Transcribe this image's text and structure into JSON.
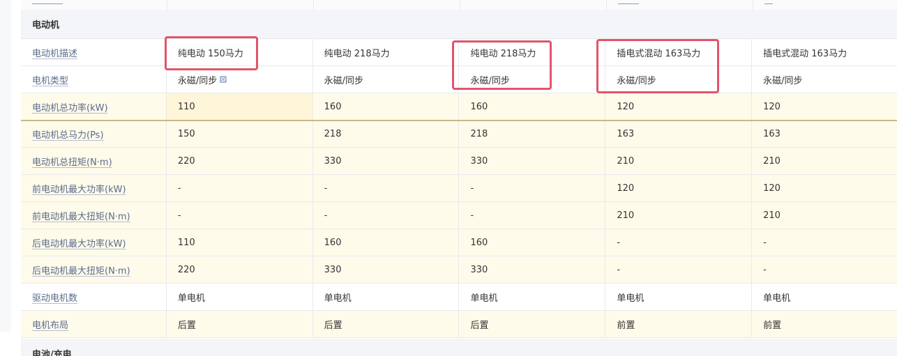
{
  "section": {
    "title": "电动机",
    "next_title": "电池/充电"
  },
  "rows": [
    {
      "label": "电动机描述",
      "values": [
        "纯电动 150马力",
        "纯电动 218马力",
        "纯电动 218马力",
        "插电式混动 163马力",
        "插电式混动 163马力"
      ],
      "style": "white"
    },
    {
      "label": "电机类型",
      "values": [
        "永磁/同步",
        "永磁/同步",
        "永磁/同步",
        "永磁/同步",
        "永磁/同步"
      ],
      "style": "white"
    },
    {
      "label": "电动机总功率(kW)",
      "values": [
        "110",
        "160",
        "160",
        "120",
        "120"
      ],
      "style": "yellow"
    },
    {
      "label": "电动机总马力(Ps)",
      "values": [
        "150",
        "218",
        "218",
        "163",
        "163"
      ],
      "style": "yellow"
    },
    {
      "label": "电动机总扭矩(N·m)",
      "values": [
        "220",
        "330",
        "330",
        "210",
        "210"
      ],
      "style": "yellow"
    },
    {
      "label": "前电动机最大功率(kW)",
      "values": [
        "-",
        "-",
        "-",
        "120",
        "120"
      ],
      "style": "yellow"
    },
    {
      "label": "前电动机最大扭矩(N·m)",
      "values": [
        "-",
        "-",
        "-",
        "210",
        "210"
      ],
      "style": "yellow"
    },
    {
      "label": "后电动机最大功率(kW)",
      "values": [
        "110",
        "160",
        "160",
        "-",
        "-"
      ],
      "style": "yellow"
    },
    {
      "label": "后电动机最大扭矩(N·m)",
      "values": [
        "220",
        "330",
        "330",
        "-",
        "-"
      ],
      "style": "yellow"
    },
    {
      "label": "驱动电机数",
      "values": [
        "单电机",
        "单电机",
        "单电机",
        "单电机",
        "单电机"
      ],
      "style": "white"
    },
    {
      "label": "电机布局",
      "values": [
        "后置",
        "后置",
        "后置",
        "前置",
        "前置"
      ],
      "style": "yellow"
    }
  ],
  "icons": {
    "motor_type_info": "search-icon"
  },
  "colors": {
    "highlight_box": "#e2546a",
    "row_yellow": "#fffbea",
    "label_link": "#5a6b8c"
  }
}
